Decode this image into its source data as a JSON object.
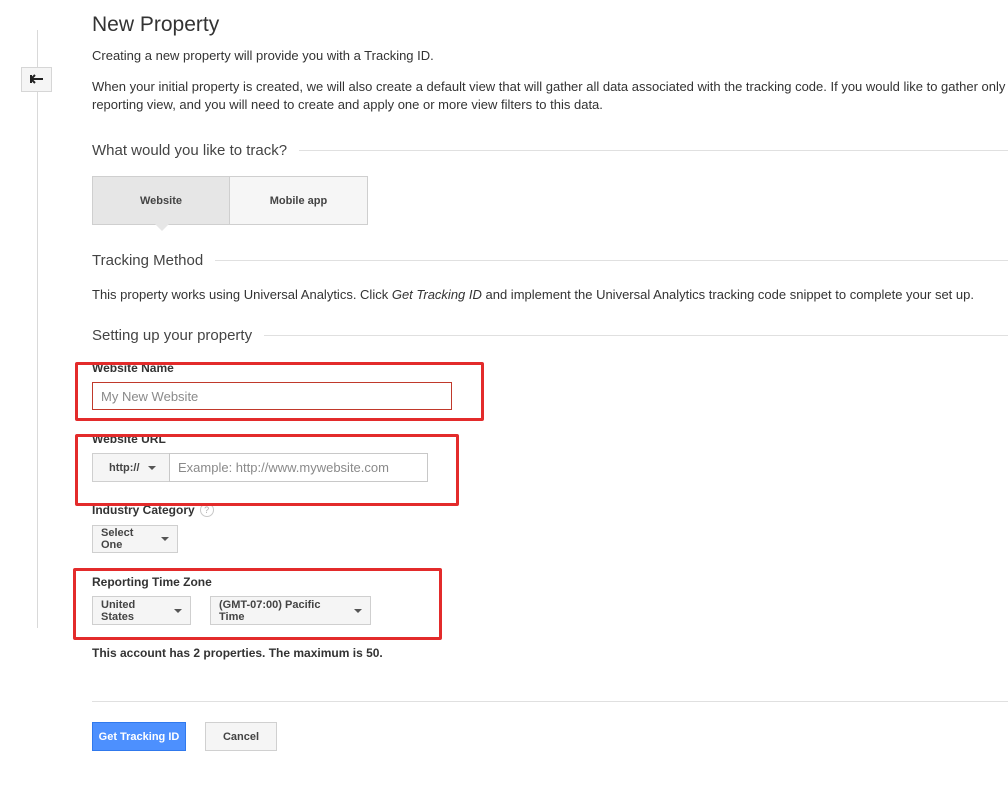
{
  "page": {
    "title": "New Property",
    "intro": "Creating a new property will provide you with a Tracking ID.",
    "description_line1": "When your initial property is created, we will also create a default view that will gather all data associated with the tracking code. If you would like to gather only",
    "description_line2": "reporting view, and you will need to create and apply one or more view filters to this data."
  },
  "nav": {
    "back_icon": "arrow-left-icon"
  },
  "track_section": {
    "heading": "What would you like to track?",
    "options": [
      {
        "label": "Website",
        "selected": true
      },
      {
        "label": "Mobile app",
        "selected": false
      }
    ]
  },
  "tracking_method": {
    "heading": "Tracking Method",
    "text_before": "This property works using Universal Analytics. Click ",
    "text_emphasis": "Get Tracking ID",
    "text_after": " and implement the Universal Analytics tracking code snippet to complete your set up."
  },
  "setup": {
    "heading": "Setting up your property",
    "website_name": {
      "label": "Website Name",
      "value": "",
      "placeholder": "My New Website"
    },
    "website_url": {
      "label": "Website URL",
      "protocol": "http://",
      "value": "",
      "placeholder": "Example: http://www.mywebsite.com"
    },
    "industry_category": {
      "label": "Industry Category",
      "help_icon": "question-mark-icon",
      "help_glyph": "?",
      "selected": "Select One"
    },
    "reporting_time_zone": {
      "label": "Reporting Time Zone",
      "country": "United States",
      "time_zone": "(GMT-07:00) Pacific Time"
    },
    "account_note": "This account has 2 properties. The maximum is 50."
  },
  "actions": {
    "primary_label": "Get Tracking ID",
    "secondary_label": "Cancel"
  },
  "colors": {
    "primary_button": "#4d90fe",
    "highlight_annotation": "#e32b2b",
    "error_border": "#c0392b"
  }
}
